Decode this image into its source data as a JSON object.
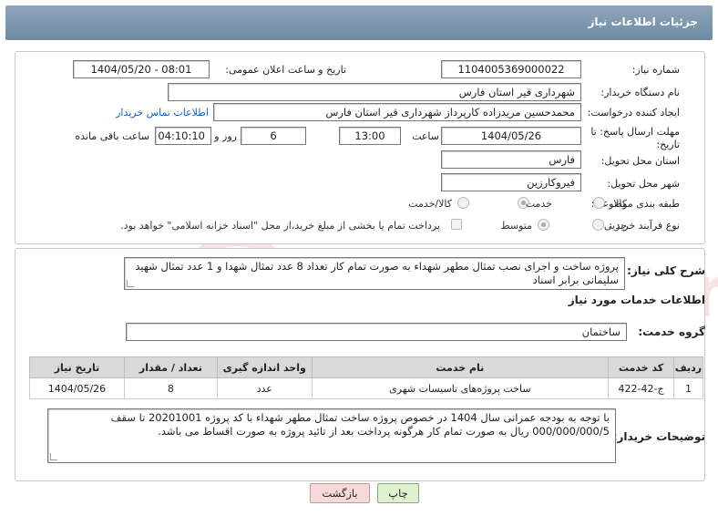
{
  "header": {
    "title": "جزئیات اطلاعات نیاز"
  },
  "form": {
    "need_number_label": "شماره نیاز:",
    "need_number": "1104005369000022",
    "announce_label": "تاریخ و ساعت اعلان عمومی:",
    "announce_value": "1404/05/20 - 08:01",
    "buyer_label": "نام دستگاه خریدار:",
    "buyer_value": "شهرداری قیر استان فارس",
    "creator_label": "ایجاد کننده درخواست:",
    "creator_value": "محمدحسین مریدزاده کارپرداز شهرداری قیر استان فارس",
    "contact_link": "اطلاعات تماس خریدار",
    "deadline_label": "مهلت ارسال پاسخ: تا تاریخ:",
    "deadline_date": "1404/05/26",
    "time_label": "ساعت",
    "deadline_time": "13:00",
    "days_value": "6",
    "days_label": "روز و",
    "remaining_value": "04:10:10",
    "remaining_label": "ساعت باقی مانده",
    "province_label": "استان محل تحویل:",
    "province_value": "فارس",
    "city_label": "شهر محل تحویل:",
    "city_value": "فیروکارزین",
    "category_label": "طبقه بندی موضوعی:",
    "category_options": [
      "کالا",
      "خدمت",
      "کالا/خدمت"
    ],
    "category_selected": 1,
    "process_label": "نوع فرآیند خرید :",
    "process_options": [
      "جزیی",
      "متوسط"
    ],
    "process_selected": 1,
    "payment_note": "پرداخت تمام یا بخشی از مبلغ خرید،از محل \"اسناد خزانه اسلامی\" خواهد بود."
  },
  "need": {
    "summary_label": "شرح کلی نیاز:",
    "summary_text": "پروژه ساخت  و اجرای نصب تمثال مطهر شهداء به صورت  تمام کار  تعداد 8 عدد تمثال شهدا و 1 عدد تمثال شهید سلیمانی برابر اسناد",
    "services_title": "اطلاعات خدمات مورد نیاز",
    "group_label": "گروه خدمت:",
    "group_value": "ساختمان",
    "table": {
      "headers": [
        "ردیف",
        "کد خدمت",
        "نام خدمت",
        "واحد اندازه گیری",
        "تعداد / مقدار",
        "تاریخ نیاز"
      ],
      "rows": [
        [
          "1",
          "ج-42-422",
          "ساخت پروژه‌های تاسیسات شهری",
          "عدد",
          "8",
          "1404/05/26"
        ]
      ]
    },
    "buyer_notes_label": "توضیحات خریدار:",
    "buyer_notes_text": "با توجه به بودجه عمرانی سال 1404 در خصوص پروژه ساخت تمثال مطهر شهداء با کد پروژه 20201001 تا سقف 000/000/000/5  ریال  به صورت تمام کار هرگونه پرداخت بعد از تائید پروژه به صورت اقساط می باشد."
  },
  "buttons": {
    "print": "چاپ",
    "back": "بازگشت"
  },
  "watermark": {
    "text": "AriaTender.net"
  },
  "colors": {
    "header": "#7b95ab",
    "link": "#1a5fb4",
    "print_bg": "#dff2cf",
    "back_bg": "#f8d9d9"
  }
}
